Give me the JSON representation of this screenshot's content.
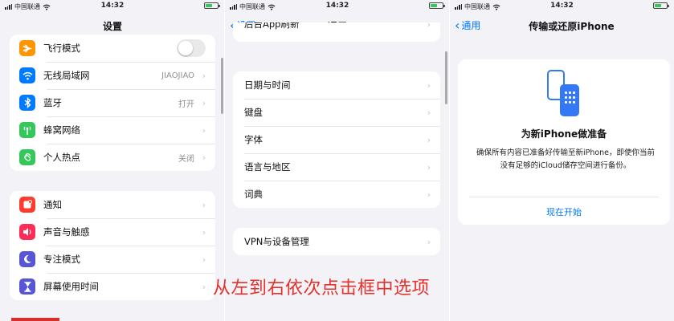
{
  "status": {
    "carrier": "中国联通",
    "time": "14:32"
  },
  "panel1": {
    "title": "设置",
    "group1": [
      {
        "label": "飞行模式",
        "value": "",
        "icon": "airplane-icon",
        "color": "#ff9500"
      },
      {
        "label": "无线局域网",
        "value": "JIAOJIAO",
        "icon": "wifi-icon",
        "color": "#007aff"
      },
      {
        "label": "蓝牙",
        "value": "打开",
        "icon": "bluetooth-icon",
        "color": "#007aff"
      },
      {
        "label": "蜂窝网络",
        "value": "",
        "icon": "cellular-icon",
        "color": "#34c759"
      },
      {
        "label": "个人热点",
        "value": "关闭",
        "icon": "hotspot-icon",
        "color": "#34c759"
      }
    ],
    "group2": [
      {
        "label": "通知",
        "icon": "notification-bell-icon",
        "color": "#ff3b30"
      },
      {
        "label": "声音与触感",
        "icon": "speaker-icon",
        "color": "#ff2d55"
      },
      {
        "label": "专注模式",
        "icon": "moon-icon",
        "color": "#5856d6"
      },
      {
        "label": "屏幕使用时间",
        "icon": "hourglass-icon",
        "color": "#5856d6"
      }
    ]
  },
  "panel2": {
    "back": "设置",
    "title": "通用",
    "partial_row": "后台App刷新",
    "group1": [
      "日期与时间",
      "键盘",
      "字体",
      "语言与地区",
      "词典"
    ],
    "group2": [
      "VPN与设备管理"
    ]
  },
  "panel3": {
    "back": "通用",
    "title": "传输或还原iPhone",
    "card_title": "为新iPhone做准备",
    "card_desc": "确保所有内容已准备好传输至新iPhone，即使你当前没有足够的iCloud储存空间进行备份。",
    "card_button": "现在开始"
  },
  "overlay_text": "从左到右依次点击框中选项"
}
